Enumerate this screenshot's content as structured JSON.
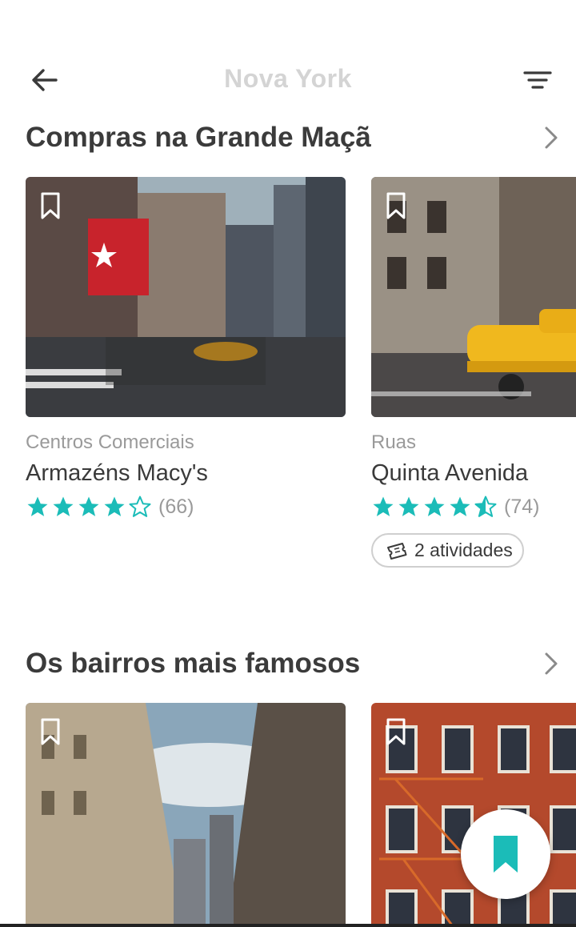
{
  "header": {
    "title": "Nova York",
    "back_icon": "arrow-left-icon",
    "filter_icon": "filter-icon"
  },
  "sections": [
    {
      "title": "Compras na Grande Maçã",
      "cards": [
        {
          "category": "Centros Comerciais",
          "name": "Armazéns Macy's",
          "rating": 4,
          "rating_text": "(66)"
        },
        {
          "category": "Ruas",
          "name": "Quinta Avenida",
          "rating": 4.5,
          "rating_text": "(74)",
          "chip": "2 atividades"
        }
      ]
    },
    {
      "title": "Os bairros mais famosos",
      "cards": [
        {},
        {}
      ]
    }
  ],
  "colors": {
    "accent": "#1bbcb8",
    "title_gray": "#3b3b3b",
    "muted": "#9a9a9a"
  },
  "fab": {
    "icon": "bookmark-icon"
  }
}
